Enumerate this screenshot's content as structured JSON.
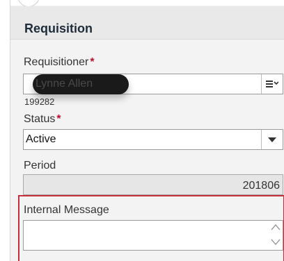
{
  "section": {
    "title": "Requisition"
  },
  "requisitioner": {
    "label": "Requisitioner",
    "required_mark": "*",
    "value": "Lynne Allen",
    "id": "199282",
    "lookup_icon": "list-dropdown-icon"
  },
  "status": {
    "label": "Status",
    "required_mark": "*",
    "value": "Active",
    "dropdown_icon": "caret-down-icon"
  },
  "period": {
    "label": "Period",
    "value": "201806"
  },
  "internal_message": {
    "label": "Internal Message",
    "value": "",
    "scroll_up_icon": "chevron-up-icon",
    "scroll_down_icon": "chevron-down-icon"
  },
  "colors": {
    "required": "#c0102e",
    "highlight": "#c62e3a",
    "header_text": "#1f2d3a"
  }
}
